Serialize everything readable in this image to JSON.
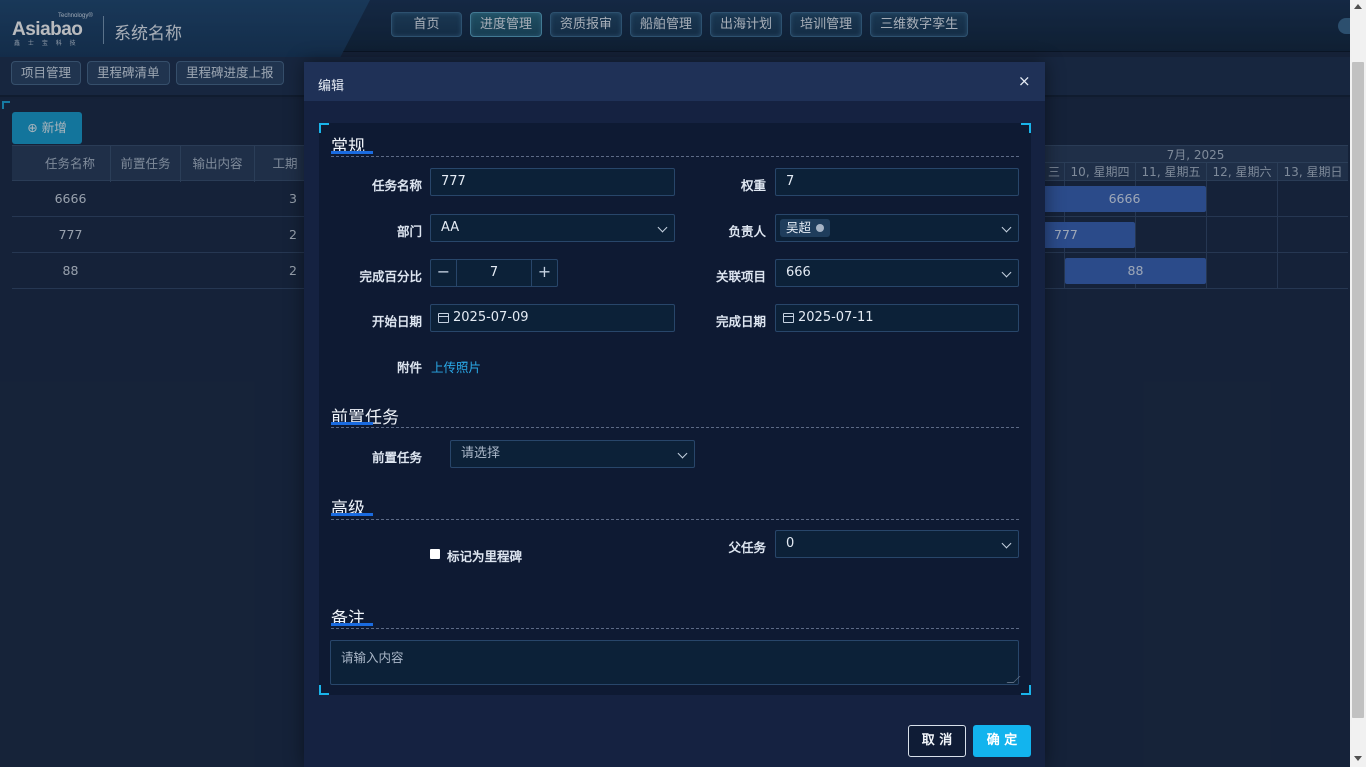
{
  "header": {
    "logo_text": "Asiabao",
    "logo_tech": "Technology®",
    "logo_sub": "鑫 士 宝 科 技",
    "system_name": "系统名称",
    "nav": [
      {
        "label": "首页",
        "active": false
      },
      {
        "label": "进度管理",
        "active": true
      },
      {
        "label": "资质报审",
        "active": false
      },
      {
        "label": "船舶管理",
        "active": false
      },
      {
        "label": "出海计划",
        "active": false
      },
      {
        "label": "培训管理",
        "active": false
      },
      {
        "label": "三维数字孪生",
        "active": false
      }
    ]
  },
  "subnav": [
    "项目管理",
    "里程碑清单",
    "里程碑进度上报"
  ],
  "toolbar": {
    "add_label": "⊕ 新增"
  },
  "grid": {
    "columns": [
      "任务名称",
      "前置任务",
      "输出内容",
      "工期"
    ],
    "rows": [
      {
        "name": "6666",
        "pre": "",
        "output": "",
        "duration": "3"
      },
      {
        "name": "777",
        "pre": "",
        "output": "",
        "duration": "2"
      },
      {
        "name": "88",
        "pre": "",
        "output": "",
        "duration": "2"
      }
    ]
  },
  "gantt": {
    "month": "7月, 2025",
    "days": [
      "三",
      "10, 星期四",
      "11, 星期五",
      "12, 星期六",
      "13, 星期日"
    ],
    "bars": [
      "6666",
      "777",
      "88"
    ]
  },
  "modal": {
    "title": "编辑",
    "close_glyph": "×",
    "sections": {
      "general": "常规",
      "predecessor": "前置任务",
      "advanced": "高级",
      "notes": "备注"
    },
    "fields": {
      "task_name": {
        "label": "任务名称",
        "value": "777"
      },
      "weight": {
        "label": "权重",
        "value": "7"
      },
      "department": {
        "label": "部门",
        "value": "AA"
      },
      "owner": {
        "label": "负责人",
        "value": "吴超"
      },
      "percent": {
        "label": "完成百分比",
        "value": "7",
        "minus": "−",
        "plus": "+"
      },
      "related_project": {
        "label": "关联项目",
        "value": "666"
      },
      "start_date": {
        "label": "开始日期",
        "value": "2025-07-09"
      },
      "end_date": {
        "label": "完成日期",
        "value": "2025-07-11"
      },
      "attachment": {
        "label": "附件",
        "link": "上传照片"
      },
      "pre_task": {
        "label": "前置任务",
        "placeholder": "请选择"
      },
      "milestone": {
        "label": "标记为里程碑",
        "checked": false
      },
      "parent_task": {
        "label": "父任务",
        "value": "0"
      },
      "notes": {
        "placeholder": "请输入内容"
      }
    },
    "buttons": {
      "cancel": "取 消",
      "ok": "确 定"
    }
  },
  "colors": {
    "accent": "#12b4ee",
    "gantt_bar": "#3b64b8",
    "section_underline": "#1a6be0"
  }
}
